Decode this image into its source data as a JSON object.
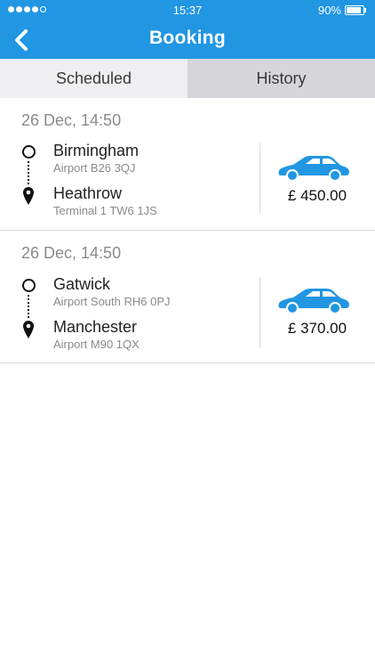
{
  "status_bar": {
    "time": "15:37",
    "battery": "90%",
    "battery_level": 0.9
  },
  "header": {
    "title": "Booking",
    "back_icon": "chevron-left-icon"
  },
  "tabs": [
    {
      "label": "Scheduled",
      "selected": true
    },
    {
      "label": "History",
      "selected": false
    }
  ],
  "bookings": [
    {
      "date": "26 Dec, 14:50",
      "pickup": {
        "name": "Birmingham",
        "detail": "Airport B26 3QJ"
      },
      "dropoff": {
        "name": "Heathrow",
        "detail": "Terminal 1 TW6 1JS"
      },
      "price": "£ 450.00",
      "vehicle_icon": "car-icon"
    },
    {
      "date": "26 Dec, 14:50",
      "pickup": {
        "name": "Gatwick",
        "detail": "Airport South RH6 0PJ"
      },
      "dropoff": {
        "name": "Manchester",
        "detail": "Airport M90 1QX"
      },
      "price": "£ 370.00",
      "vehicle_icon": "car-icon"
    }
  ],
  "colors": {
    "accent": "#2196e3",
    "tab_active": "#efeff1",
    "tab_inactive": "#d5d5da",
    "car": "#2196e3"
  }
}
